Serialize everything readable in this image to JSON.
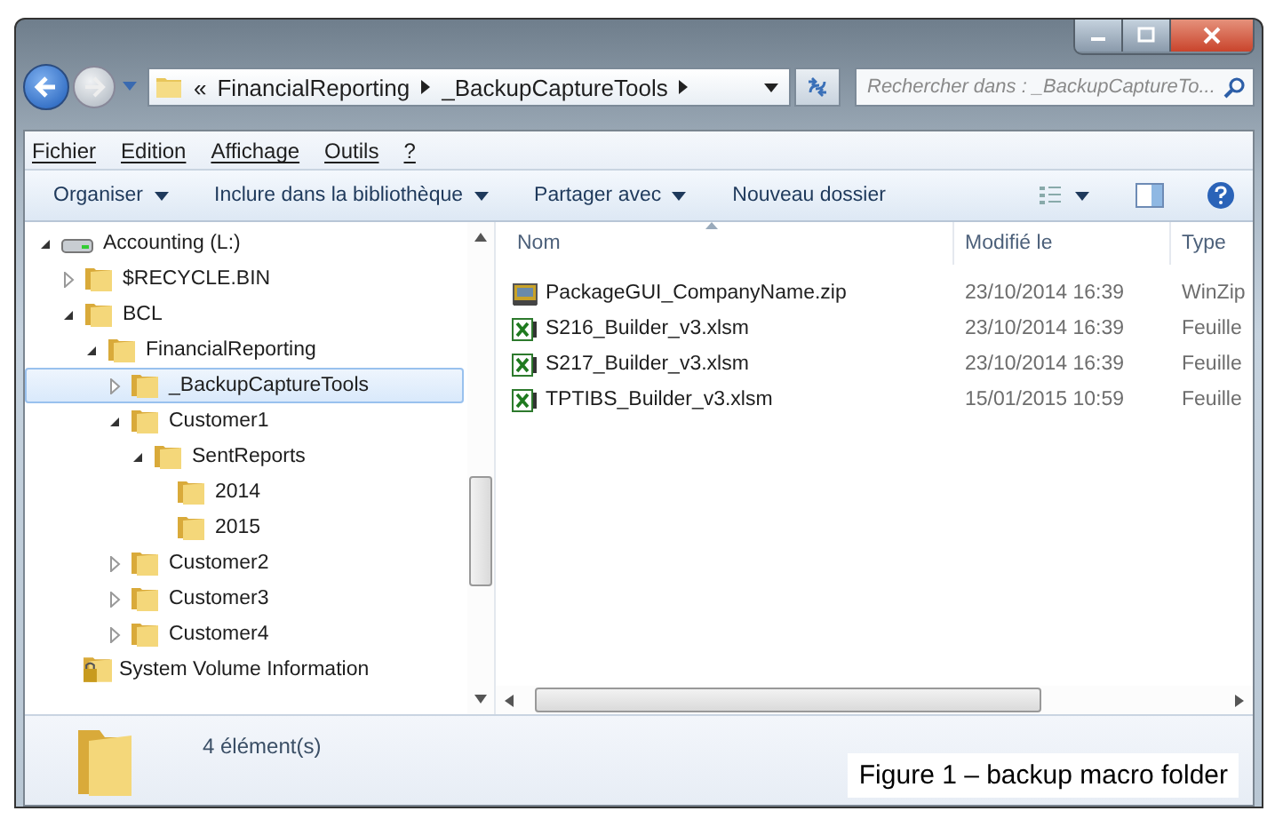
{
  "address_bar": {
    "overflow": "«",
    "crumbs": [
      "FinancialReporting",
      "_BackupCaptureTools"
    ]
  },
  "search": {
    "placeholder": "Rechercher dans : _BackupCaptureTo..."
  },
  "menu": [
    "Fichier",
    "Edition",
    "Affichage",
    "Outils",
    "?"
  ],
  "toolbar": [
    {
      "label": "Organiser",
      "dropdown": true
    },
    {
      "label": "Inclure dans la bibliothèque",
      "dropdown": true
    },
    {
      "label": "Partager avec",
      "dropdown": true
    },
    {
      "label": "Nouveau dossier",
      "dropdown": false
    }
  ],
  "tree": [
    {
      "label": "Accounting (L:)",
      "kind": "drive",
      "expanded": true,
      "selected": false,
      "children": [
        {
          "label": "$RECYCLE.BIN",
          "kind": "folder",
          "expanded": false,
          "selected": false
        },
        {
          "label": "BCL",
          "kind": "folder",
          "expanded": true,
          "selected": false,
          "children": [
            {
              "label": "FinancialReporting",
              "kind": "folder",
              "expanded": true,
              "selected": false,
              "children": [
                {
                  "label": "_BackupCaptureTools",
                  "kind": "folder",
                  "expanded": false,
                  "selected": true
                },
                {
                  "label": "Customer1",
                  "kind": "folder",
                  "expanded": true,
                  "selected": false,
                  "children": [
                    {
                      "label": "SentReports",
                      "kind": "folder",
                      "expanded": true,
                      "selected": false,
                      "children": [
                        {
                          "label": "2014",
                          "kind": "folder",
                          "selected": false
                        },
                        {
                          "label": "2015",
                          "kind": "folder",
                          "selected": false
                        }
                      ]
                    }
                  ]
                },
                {
                  "label": "Customer2",
                  "kind": "folder",
                  "expanded": false,
                  "selected": false
                },
                {
                  "label": "Customer3",
                  "kind": "folder",
                  "expanded": false,
                  "selected": false
                },
                {
                  "label": "Customer4",
                  "kind": "folder",
                  "expanded": false,
                  "selected": false
                }
              ]
            }
          ]
        },
        {
          "label": "System Volume Information",
          "kind": "locked-folder",
          "selected": false
        }
      ]
    }
  ],
  "file_list": {
    "columns": [
      "Nom",
      "Modifié le",
      "Type"
    ],
    "rows": [
      {
        "name": "PackageGUI_CompanyName.zip",
        "kind": "zip",
        "modified": "23/10/2014 16:39",
        "type": "WinZip"
      },
      {
        "name": "S216_Builder_v3.xlsm",
        "kind": "excel",
        "modified": "23/10/2014 16:39",
        "type": "Feuille"
      },
      {
        "name": "S217_Builder_v3.xlsm",
        "kind": "excel",
        "modified": "23/10/2014 16:39",
        "type": "Feuille"
      },
      {
        "name": "TPTIBS_Builder_v3.xlsm",
        "kind": "excel",
        "modified": "15/01/2015 10:59",
        "type": "Feuille"
      }
    ]
  },
  "status_bar": {
    "count": "4 élément(s)"
  },
  "caption": "Figure 1 – backup macro folder"
}
